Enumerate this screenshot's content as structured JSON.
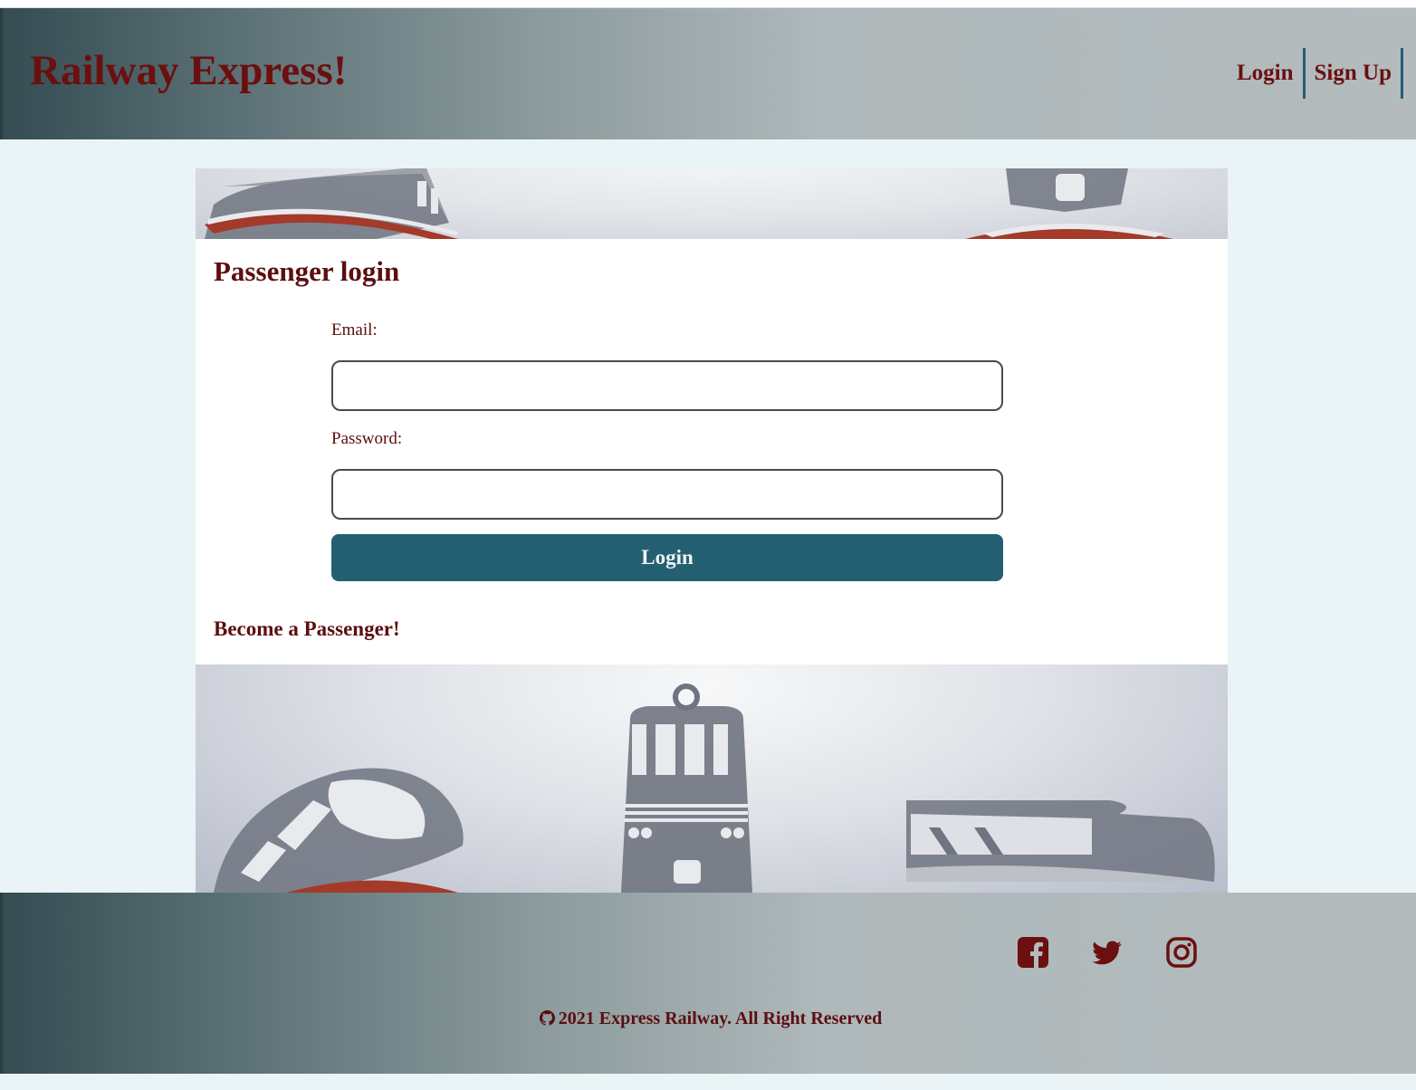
{
  "header": {
    "brand": "Railway Express!",
    "nav": [
      {
        "label": "Login"
      },
      {
        "label": "Sign Up"
      }
    ]
  },
  "form": {
    "title": "Passenger login",
    "email_label": "Email:",
    "email_value": "",
    "password_label": "Password:",
    "password_value": "",
    "submit_label": "Login",
    "signup_link": "Become a Passenger!"
  },
  "footer": {
    "social_icons": [
      "facebook-icon",
      "twitter-icon",
      "instagram-icon"
    ],
    "copyright": "2021 Express Railway. All Right Reserved",
    "copyright_icon": "github-icon"
  },
  "colors": {
    "brand_text": "#6b0f0f",
    "accent": "#245f71",
    "background": "#eaf3f5"
  }
}
